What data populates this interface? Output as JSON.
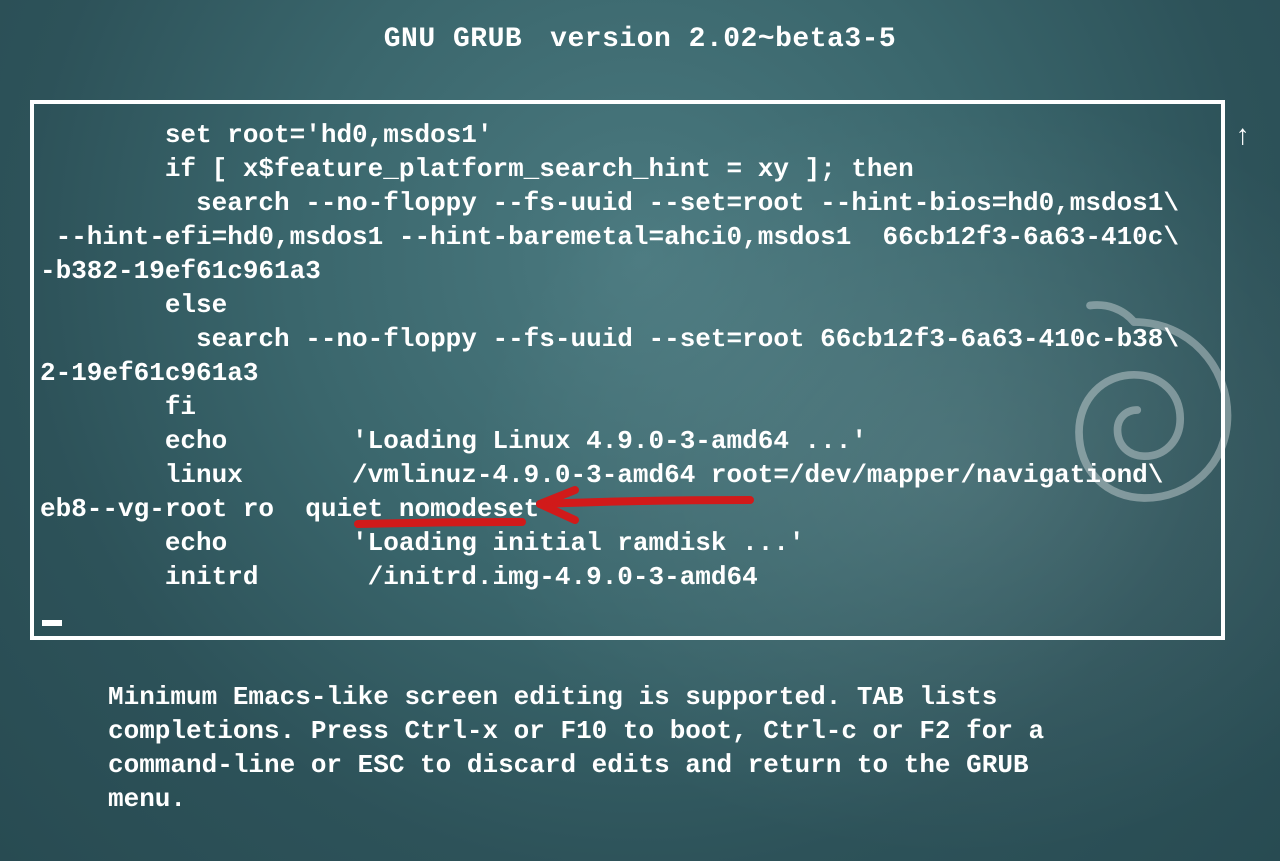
{
  "header": {
    "product": "GNU GRUB",
    "version_label": "version 2.02~beta3-5"
  },
  "editor": {
    "lines": [
      "        set root='hd0,msdos1'",
      "        if [ x$feature_platform_search_hint = xy ]; then",
      "          search --no-floppy --fs-uuid --set=root --hint-bios=hd0,msdos1\\",
      " --hint-efi=hd0,msdos1 --hint-baremetal=ahci0,msdos1  66cb12f3-6a63-410c\\",
      "-b382-19ef61c961a3",
      "        else",
      "          search --no-floppy --fs-uuid --set=root 66cb12f3-6a63-410c-b38\\",
      "2-19ef61c961a3",
      "        fi",
      "        echo        'Loading Linux 4.9.0-3-amd64 ...'",
      "        linux       /vmlinuz-4.9.0-3-amd64 root=/dev/mapper/navigationd\\",
      "eb8--vg-root ro  quiet nomodeset",
      "        echo        'Loading initial ramdisk ...'",
      "        initrd       /initrd.img-4.9.0-3-amd64"
    ],
    "scroll_indicator": "↑"
  },
  "help": {
    "text": "Minimum Emacs-like screen editing is supported. TAB lists\ncompletions. Press Ctrl-x or F10 to boot, Ctrl-c or F2 for a\ncommand-line or ESC to discard edits and return to the GRUB\nmenu."
  },
  "annotation": {
    "color": "#d11a1a",
    "target_word": "nomodeset"
  },
  "logo": {
    "name": "debian-swirl"
  }
}
